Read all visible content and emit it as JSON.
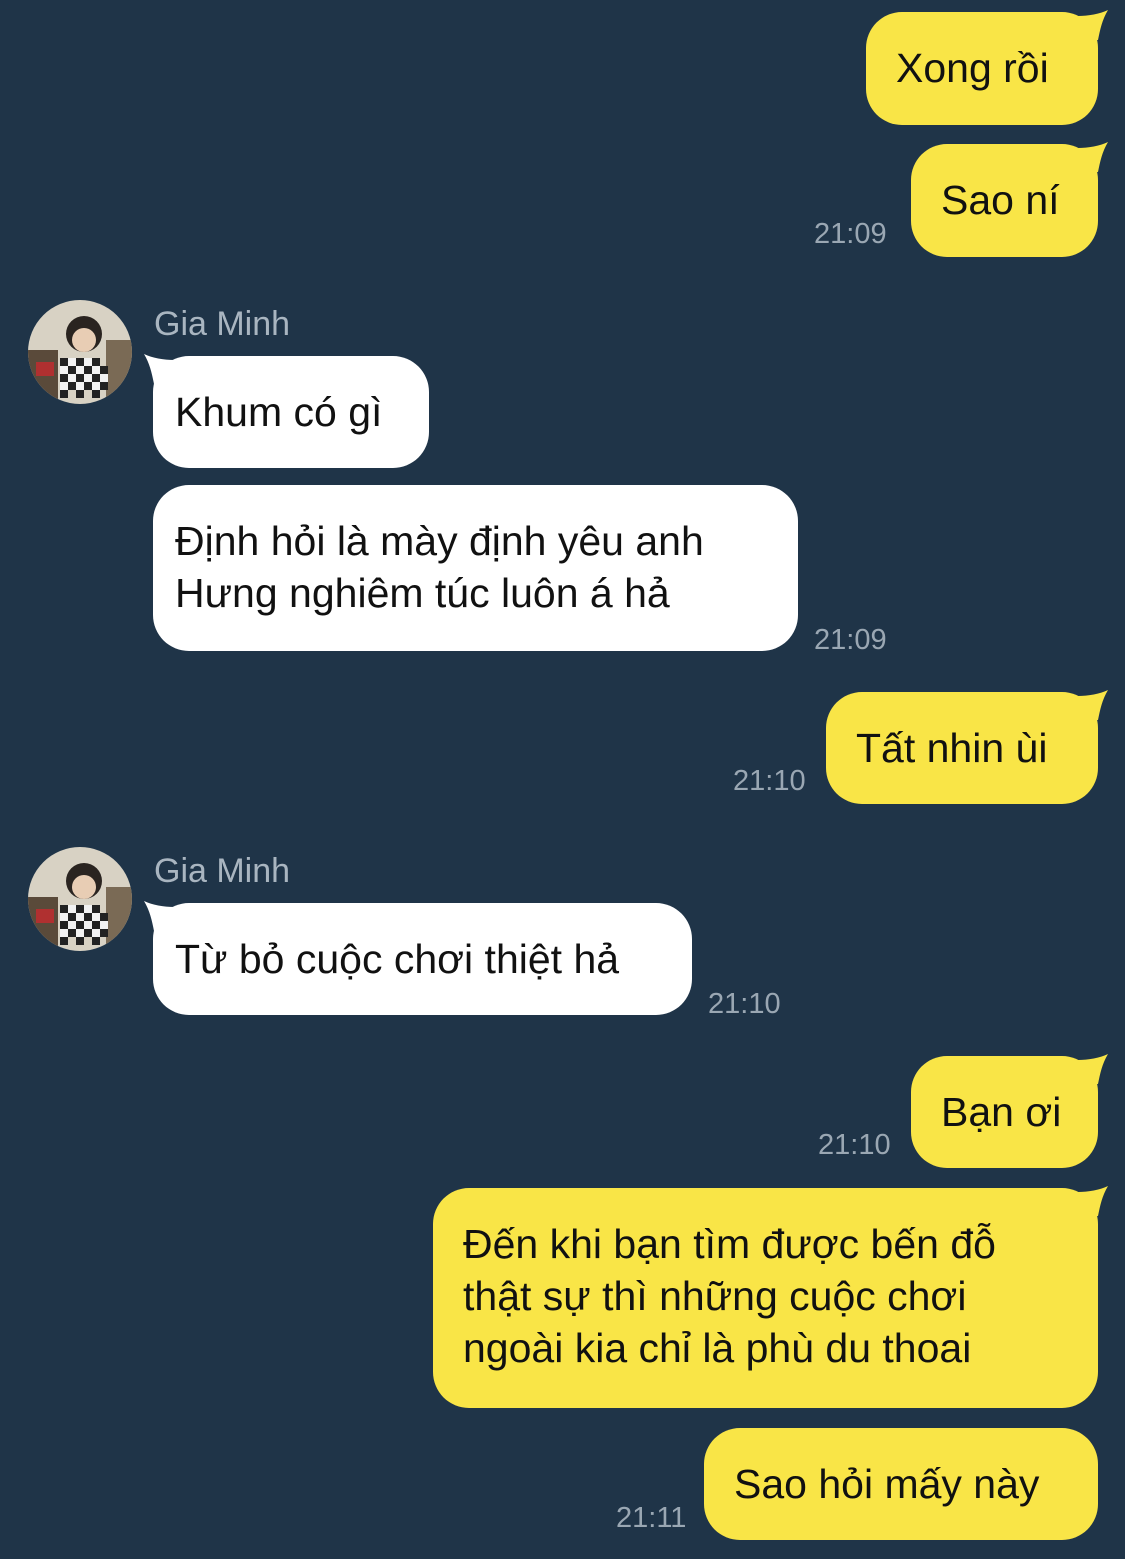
{
  "colors": {
    "background": "#1f3448",
    "outgoing_bubble": "#f9e547",
    "incoming_bubble": "#ffffff",
    "timestamp": "#9aa7b3",
    "sender_name": "#a9b5c0"
  },
  "messages": {
    "m1": {
      "text": "Xong rồi"
    },
    "m2": {
      "text": "Sao ní",
      "time": "21:09"
    },
    "g1": {
      "sender": "Gia Minh",
      "avatar": "user-avatar-photo"
    },
    "m3": {
      "text": "Khum có gì"
    },
    "m4": {
      "text": "Định hỏi là mày định yêu anh\nHưng nghiêm túc luôn á hả",
      "time": "21:09"
    },
    "m5": {
      "text": "Tất nhin ùi",
      "time": "21:10"
    },
    "g2": {
      "sender": "Gia Minh",
      "avatar": "user-avatar-photo"
    },
    "m6": {
      "text": "Từ bỏ cuộc chơi thiệt hả",
      "time": "21:10"
    },
    "m7": {
      "text": "Bạn ơi",
      "time": "21:10"
    },
    "m8": {
      "text": "Đến khi bạn tìm được bến đỗ\nthật sự thì những cuộc chơi\nngoài kia chỉ là phù du thoai"
    },
    "m9": {
      "text": "Sao hỏi mấy này",
      "time": "21:11"
    }
  }
}
